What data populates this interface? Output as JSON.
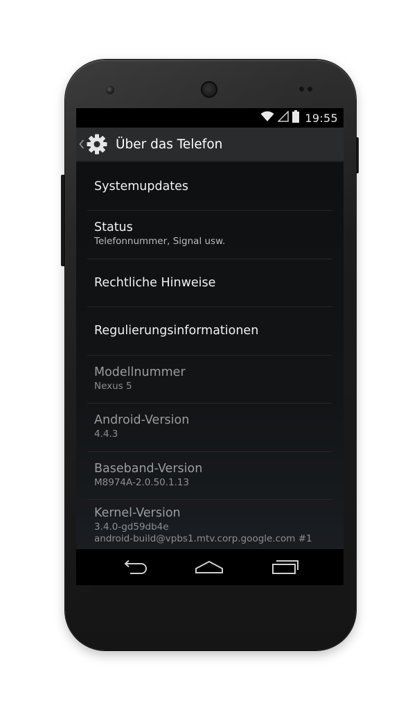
{
  "status_bar": {
    "time": "19:55",
    "icons": [
      "wifi-icon",
      "signal-icon",
      "battery-icon"
    ]
  },
  "action_bar": {
    "title": "Über das Telefon",
    "up_icon": "chevron-left-icon",
    "app_icon": "settings-gear-icon"
  },
  "preferences": [
    {
      "title": "Systemupdates",
      "summary": "",
      "enabled": true
    },
    {
      "title": "Status",
      "summary": "Telefonnummer, Signal usw.",
      "enabled": true
    },
    {
      "title": "Rechtliche Hinweise",
      "summary": "",
      "enabled": true
    },
    {
      "title": "Regulierungsinformationen",
      "summary": "",
      "enabled": true
    },
    {
      "title": "Modellnummer",
      "summary": "Nexus 5",
      "enabled": false
    },
    {
      "title": "Android-Version",
      "summary": "4.4.3",
      "enabled": false
    },
    {
      "title": "Baseband-Version",
      "summary": "M8974A-2.0.50.1.13",
      "enabled": false
    },
    {
      "title": "Kernel-Version",
      "summary": "3.4.0-gd59db4e",
      "summary2": "android-build@vpbs1.mtv.corp.google.com #1",
      "enabled": false
    }
  ],
  "nav_bar": {
    "buttons": [
      "back-icon",
      "home-icon",
      "recents-icon"
    ]
  },
  "colors": {
    "action_bar": "#2a2b2d",
    "screen_bg": "#0e0f11",
    "divider": "#25272a",
    "phone_body": "#1c1c1c"
  }
}
